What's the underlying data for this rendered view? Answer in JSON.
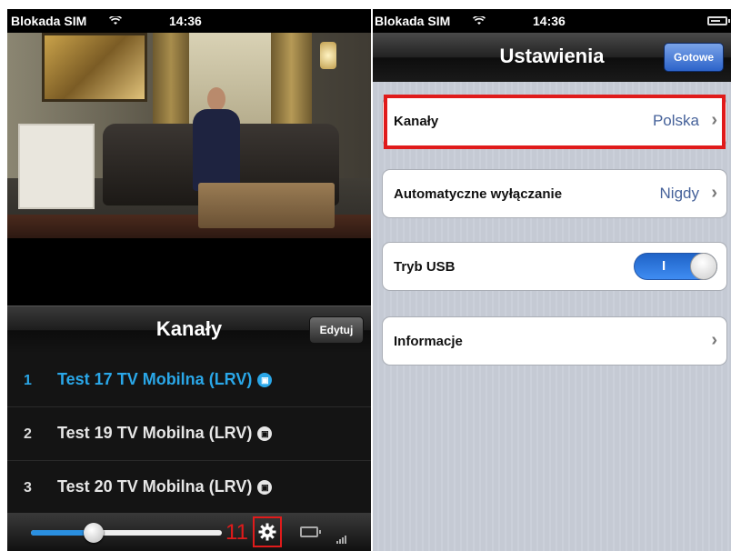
{
  "left_screen": {
    "status": {
      "carrier": "Blokada SIM",
      "time": "14:36"
    },
    "header": {
      "title": "Kanały",
      "edit_label": "Edytuj"
    },
    "channels": [
      {
        "num": "1",
        "name": "Test 17 TV Mobilna (LRV)",
        "active": true
      },
      {
        "num": "2",
        "name": "Test 19 TV Mobilna (LRV)",
        "active": false
      },
      {
        "num": "3",
        "name": "Test 20 TV Mobilna (LRV)",
        "active": false
      }
    ],
    "toolbar": {
      "volume_fraction": 0.33,
      "callout_number": "11"
    }
  },
  "right_screen": {
    "status": {
      "carrier": "Blokada SIM",
      "time": "14:36"
    },
    "nav": {
      "title": "Ustawienia",
      "done_label": "Gotowe"
    },
    "rows": [
      {
        "label": "Kanały",
        "value": "Polska"
      },
      {
        "label": "Automatyczne wyłączanie",
        "value": "Nigdy"
      },
      {
        "label": "Tryb USB",
        "toggle_text": "I",
        "toggle_on": true
      },
      {
        "label": "Informacje"
      }
    ]
  },
  "colors": {
    "accent_blue": "#2aa7e8",
    "callout_red": "#e01b1b",
    "done_blue": "#2c63c9"
  },
  "icons": [
    "wifi-icon",
    "battery-icon",
    "gear-icon",
    "signal-icon",
    "chevron-right-icon",
    "tv-badge-icon"
  ]
}
